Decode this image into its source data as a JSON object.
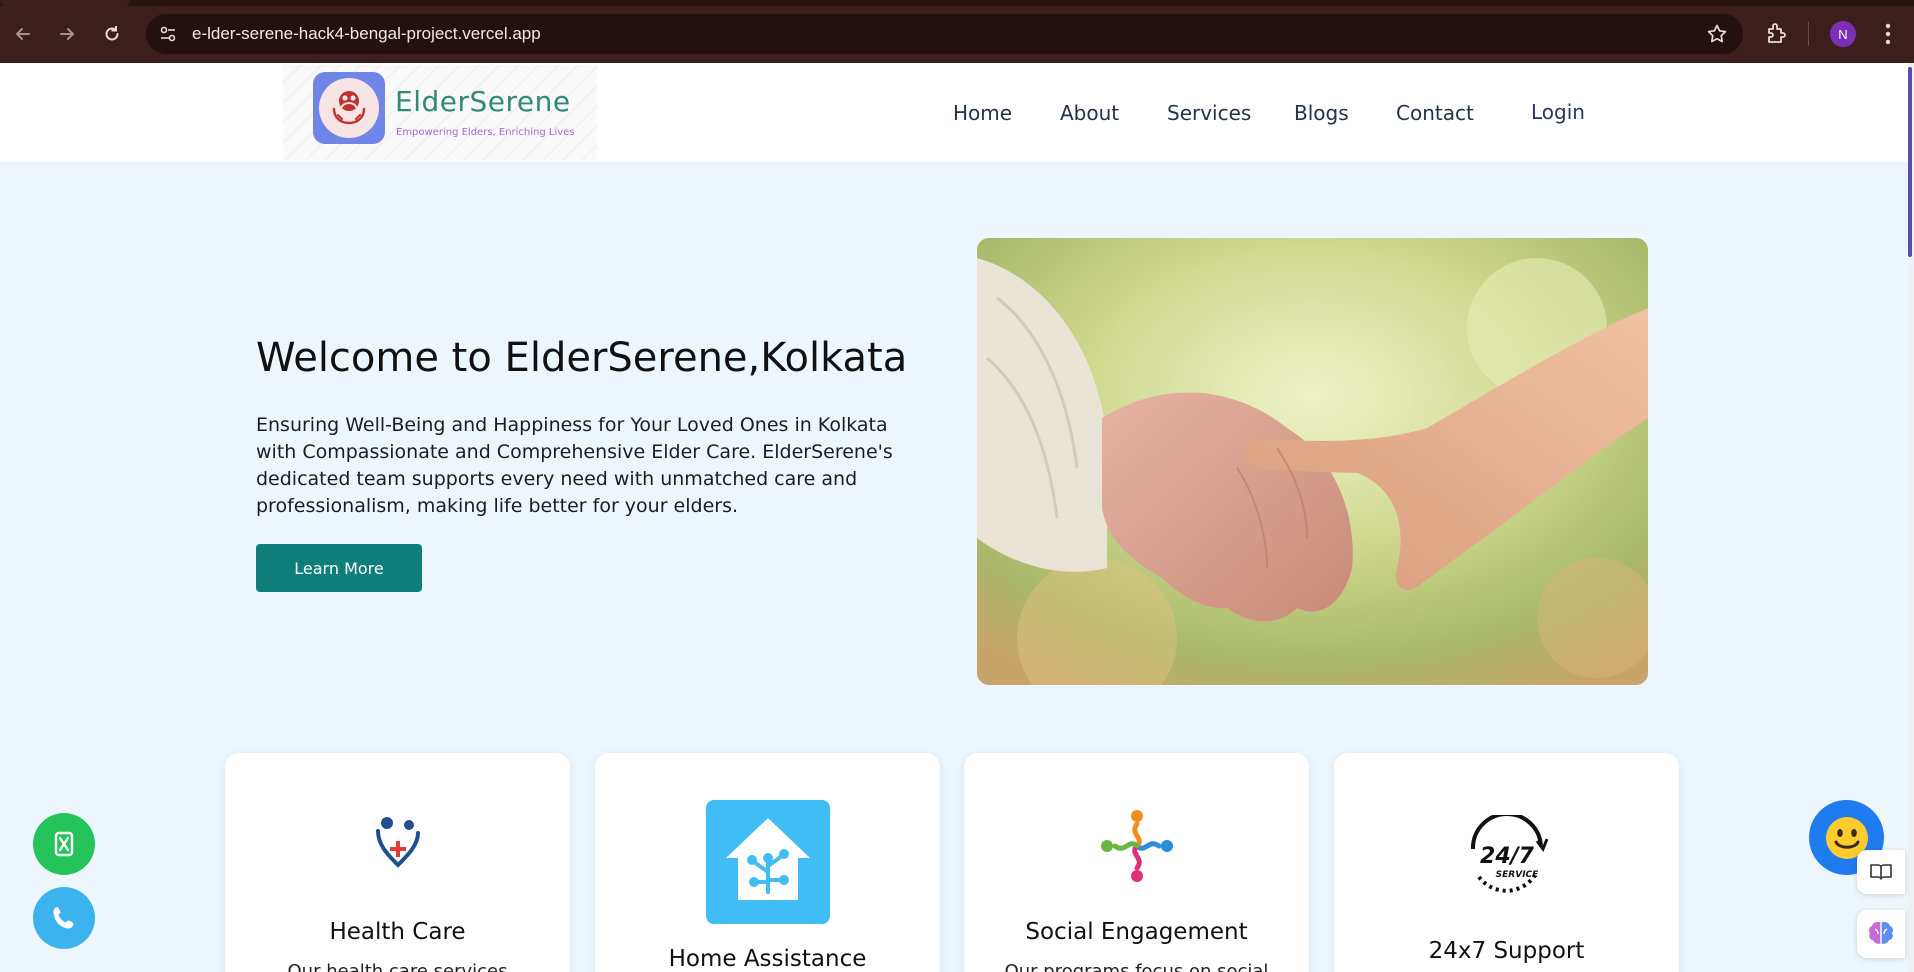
{
  "browser": {
    "url": "e-lder-serene-hack4-bengal-project.vercel.app",
    "profile_initial": "N",
    "icons": [
      "back-arrow-icon",
      "forward-arrow-icon",
      "reload-icon",
      "site-settings-icon",
      "bookmark-star-icon",
      "extensions-icon",
      "menu-kebab-icon"
    ]
  },
  "header": {
    "brand": "ElderSerene",
    "tagline": "Empowering Elders, Enriching Lives",
    "nav": [
      "Home",
      "About",
      "Services",
      "Blogs",
      "Contact"
    ],
    "login": "Login"
  },
  "hero": {
    "title": "Welcome to ElderSerene,Kolkata",
    "text": "Ensuring Well-Being and Happiness for Your Loved Ones in Kolkata with Compassionate and Comprehensive Elder Care. ElderSerene's dedicated team supports every need with unmatched care and professionalism, making life better for your elders.",
    "cta": "Learn More"
  },
  "cards": [
    {
      "title": "Health Care",
      "desc": "Our health care services",
      "icon": "health-care-icon"
    },
    {
      "title": "Home Assistance",
      "desc": "",
      "icon": "smart-home-icon"
    },
    {
      "title": "Social Engagement",
      "desc": "Our programs focus on social",
      "icon": "social-engagement-icon"
    },
    {
      "title": "24x7 Support",
      "desc": "",
      "icon": "24-7-service-icon",
      "icon_text": "24/7",
      "icon_subtext": "SERVICE"
    }
  ],
  "colors": {
    "accent_teal": "#0f7e7b",
    "page_bg": "#eef6fd",
    "chrome_bg": "#3c1f1c",
    "whatsapp_green": "#25c35a",
    "phone_blue": "#3bb3ee",
    "chatbot_blue": "#1e7bf0"
  }
}
